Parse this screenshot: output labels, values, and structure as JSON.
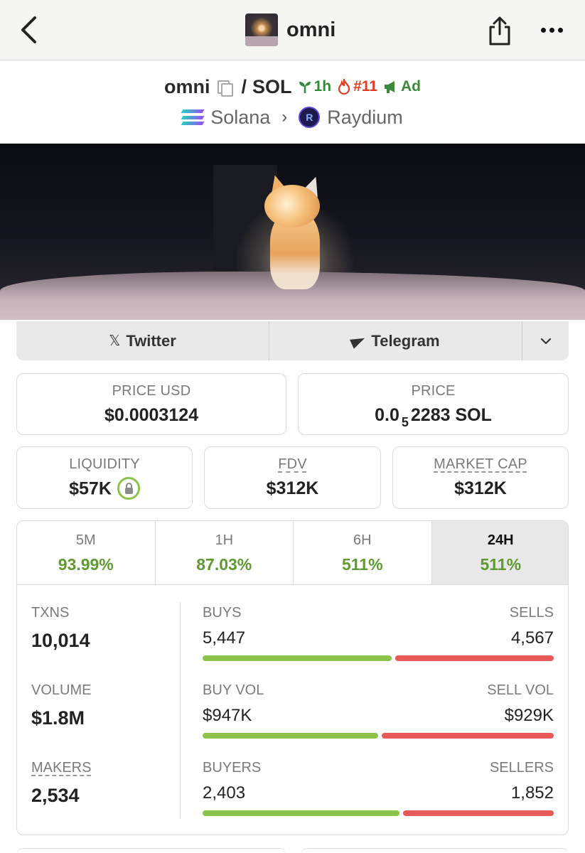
{
  "nav": {
    "title": "omni"
  },
  "pair": {
    "token": "omni",
    "separator": "/",
    "quote": "SOL",
    "age_tag": "1h",
    "rank_tag": "#11",
    "ad_tag": "Ad",
    "chain": "Solana",
    "dex": "Raydium"
  },
  "social": {
    "twitter_label": "Twitter",
    "telegram_label": "Telegram"
  },
  "price": {
    "usd_label": "PRICE USD",
    "usd_value": "$0.0003124",
    "native_label": "PRICE",
    "native_prefix": "0.0",
    "native_zeros": "5",
    "native_rest": "2283 SOL"
  },
  "metrics": {
    "liquidity_label": "LIQUIDITY",
    "liquidity_value": "$57K",
    "fdv_label": "FDV",
    "fdv_value": "$312K",
    "mcap_label": "MARKET CAP",
    "mcap_value": "$312K"
  },
  "tabs": [
    {
      "name": "5M",
      "value": "93.99%"
    },
    {
      "name": "1H",
      "value": "87.03%"
    },
    {
      "name": "6H",
      "value": "511%"
    },
    {
      "name": "24H",
      "value": "511%"
    }
  ],
  "stats": {
    "txns_label": "TXNS",
    "txns_value": "10,014",
    "volume_label": "VOLUME",
    "volume_value": "$1.8M",
    "makers_label": "MAKERS",
    "makers_value": "2,534",
    "buys_label": "BUYS",
    "buys_value": "5,447",
    "sells_label": "SELLS",
    "sells_value": "4,567",
    "buys_share": 0.544,
    "buy_vol_label": "BUY VOL",
    "buy_vol_value": "$947K",
    "sell_vol_label": "SELL VOL",
    "sell_vol_value": "$929K",
    "vol_share": 0.505,
    "buyers_label": "BUYERS",
    "buyers_value": "2,403",
    "sellers_label": "SELLERS",
    "sellers_value": "1,852",
    "buyers_share": 0.565
  },
  "colors": {
    "positive": "#5e9a30",
    "buy_bar": "#8cc34a",
    "sell_bar": "#e85a57"
  }
}
